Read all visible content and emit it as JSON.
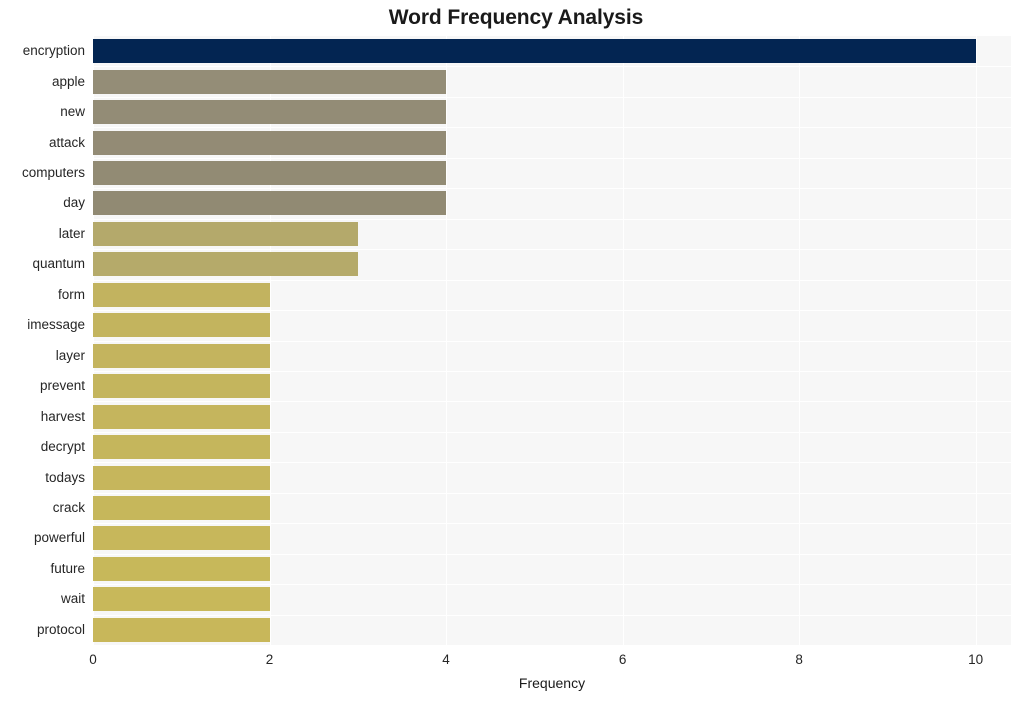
{
  "chart_data": {
    "type": "bar",
    "orientation": "horizontal",
    "title": "Word Frequency Analysis",
    "xlabel": "Frequency",
    "ylabel": "",
    "xlim": [
      0,
      10.4
    ],
    "xticks": [
      "0",
      "2",
      "4",
      "6",
      "8",
      "10"
    ],
    "xtick_values": [
      0,
      2,
      4,
      6,
      8,
      10
    ],
    "grid": true,
    "legend": null,
    "plot_background": "#f7f7f7",
    "figure_background": "#ffffff",
    "categories": [
      "encryption",
      "apple",
      "new",
      "attack",
      "computers",
      "day",
      "later",
      "quantum",
      "form",
      "imessage",
      "layer",
      "prevent",
      "harvest",
      "decrypt",
      "todays",
      "crack",
      "powerful",
      "future",
      "wait",
      "protocol"
    ],
    "values": [
      10,
      4,
      4,
      4,
      4,
      4,
      3,
      3,
      2,
      2,
      2,
      2,
      2,
      2,
      2,
      2,
      2,
      2,
      2,
      2
    ],
    "bar_colors": [
      "#032552",
      "#948d77",
      "#938c76",
      "#938b75",
      "#928b74",
      "#918a73",
      "#b4a96b",
      "#b5aa6a",
      "#c2b35f",
      "#c3b45e",
      "#c4b45e",
      "#c4b55d",
      "#c5b55d",
      "#c5b65c",
      "#c6b65c",
      "#c6b75b",
      "#c7b75b",
      "#c7b85a",
      "#c8b85a",
      "#c8b75a"
    ]
  }
}
